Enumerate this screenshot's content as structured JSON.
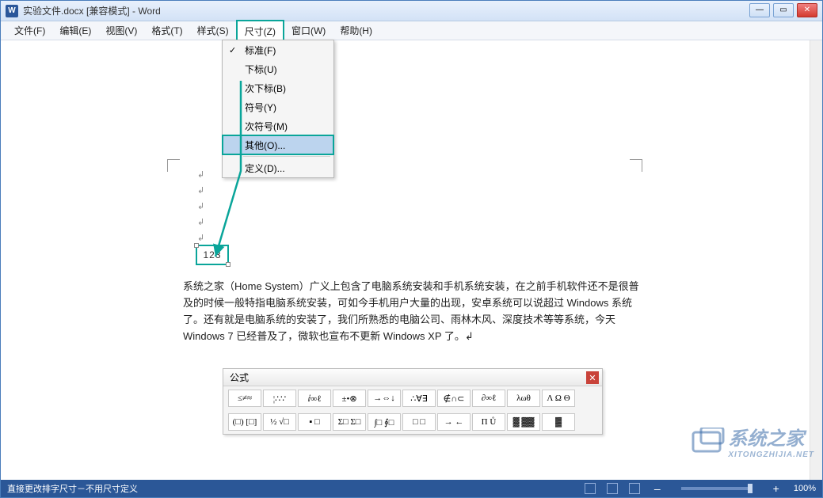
{
  "title": "实验文件.docx [兼容模式] - Word",
  "menu": {
    "items": [
      "文件(F)",
      "编辑(E)",
      "视图(V)",
      "格式(T)",
      "样式(S)",
      "尺寸(Z)",
      "窗口(W)",
      "帮助(H)"
    ],
    "active_index": 5
  },
  "dropdown": {
    "items": [
      {
        "label": "标准(F)",
        "checked": true
      },
      {
        "label": "下标(U)"
      },
      {
        "label": "次下标(B)"
      },
      {
        "label": "符号(Y)"
      },
      {
        "label": "次符号(M)"
      },
      {
        "label": "其他(O)...",
        "highlight": true,
        "boxed": true
      },
      {
        "sep": true
      },
      {
        "label": "定义(D)..."
      }
    ]
  },
  "object_text": "123",
  "body_paragraph": "系统之家（Home System）广义上包含了电脑系统安装和手机系统安装，在之前手机软件还不是很普及的时候一般特指电脑系统安装，可如今手机用户大量的出现，安卓系统可以说超过 Windows 系统了。还有就是电脑系统的安装了，我们所熟悉的电脑公司、雨林木风、深度技术等等系统，今天 Windows 7 已经普及了，微软也宣布不更新 Windows XP 了。↲",
  "equation_toolbar": {
    "title": "公式",
    "row1": [
      "≤≠≈",
      "¦∴∵",
      "ⅈ∞ℓ",
      "±•⊗",
      "→⇔↓",
      "∴∀∃",
      "∉∩⊂",
      "∂∞ℓ",
      "λωθ",
      "Λ Ω Θ"
    ],
    "row2": [
      "(□) [□]",
      "½ √□",
      "▪ □",
      "Σ□ Σ□",
      "∫□ ∮□",
      "□ □",
      "→ ←",
      "Π Ů",
      "▓ ▓▓",
      "▓"
    ]
  },
  "status": {
    "left_text": "直接更改排字尺寸－不用尺寸定义",
    "zoom": "100%"
  },
  "watermark": {
    "main": "系统之家",
    "sub": "XITONGZHIJIA.NET"
  }
}
